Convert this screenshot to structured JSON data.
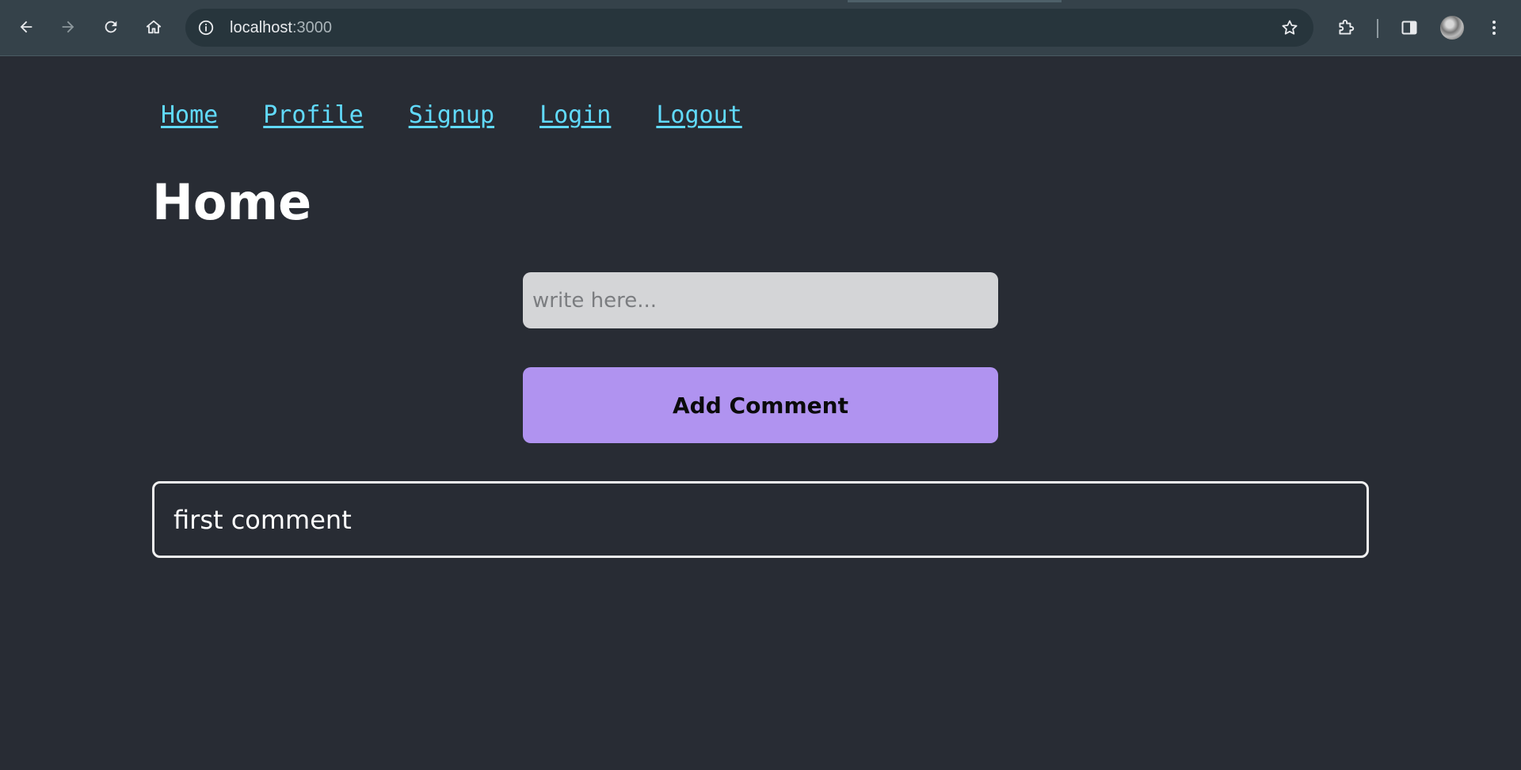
{
  "browser": {
    "url_host": "localhost",
    "url_port": ":3000",
    "icons": {
      "back": "back-arrow-icon",
      "forward": "forward-arrow-icon",
      "reload": "reload-icon",
      "home": "home-icon",
      "site_info": "info-icon",
      "bookmark": "star-icon",
      "extensions": "puzzle-icon",
      "side_panel": "side-panel-icon",
      "profile": "avatar",
      "menu": "kebab-menu-icon"
    }
  },
  "nav": {
    "links": [
      {
        "label": "Home"
      },
      {
        "label": "Profile"
      },
      {
        "label": "Signup"
      },
      {
        "label": "Login"
      },
      {
        "label": "Logout"
      }
    ]
  },
  "main": {
    "title": "Home",
    "input": {
      "placeholder": "write here...",
      "value": ""
    },
    "add_button_label": "Add Comment",
    "comments": [
      {
        "text": "first comment"
      }
    ]
  },
  "colors": {
    "background": "#282c34",
    "link": "#61dafb",
    "button": "#b093f0",
    "input_bg": "#d4d5d7"
  }
}
